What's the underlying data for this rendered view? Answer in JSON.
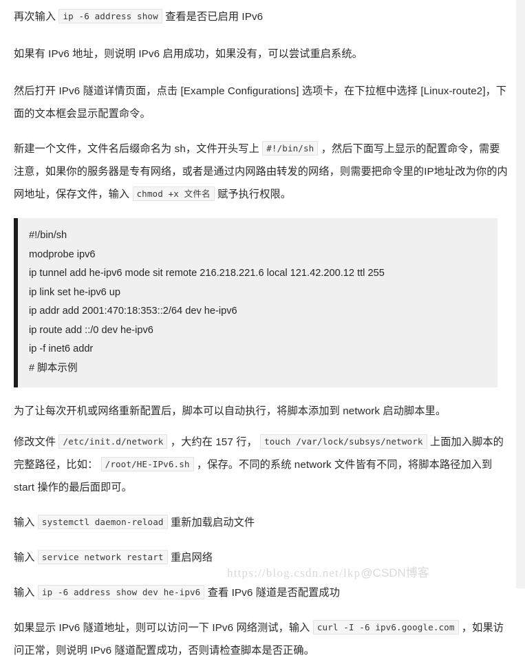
{
  "document": {
    "type": "blog-article-body",
    "language": "zh-CN",
    "topic": "IPv6 tunnel configuration (HE tunnelbroker) on Linux"
  },
  "paragraphs": {
    "p1": {
      "before": "再次输入",
      "code": "ip -6 address show",
      "after": "查看是否已启用 IPv6"
    },
    "p2": "如果有 IPv6 地址，则说明 IPv6 启用成功，如果没有，可以尝试重启系统。",
    "p3": "然后打开 IPv6 隧道详情页面，点击 [Example Configurations] 选项卡，在下拉框中选择 [Linux-route2]，下面的文本框会显示配置命令。",
    "p4": {
      "seg1": "新建一个文件，文件名后缀命名为 sh，文件开头写上",
      "code1": "#!/bin/sh",
      "seg2": "，然后下面写上显示的配置命令，需要注意，如果你的服务器是专有网络，或者是通过内网路由转发的网络，则需要把命令里的IP地址改为你的内网地址，保存文件，输入",
      "code2": "chmod +x 文件名",
      "seg3": "赋予执行权限。"
    },
    "p5": "为了让每次开机或网络重新配置后，脚本可以自动执行，将脚本添加到 network 启动脚本里。",
    "p6": {
      "seg1": "修改文件",
      "code1": "/etc/init.d/network",
      "seg2": "，大约在 157 行，",
      "code2": "touch /var/lock/subsys/network",
      "seg3": "上面加入脚本的完整路径，比如：",
      "code3": "/root/HE-IPv6.sh",
      "seg4": "，保存。不同的系统 network 文件皆有不同，将脚本路径加入到 start 操作的最后面即可。"
    },
    "p7": {
      "before": "输入",
      "code": "systemctl daemon-reload",
      "after": "重新加载启动文件"
    },
    "p8": {
      "before": "输入",
      "code": "service network restart",
      "after": "重启网络"
    },
    "p9": {
      "before": "输入",
      "code": "ip -6 address show dev he-ipv6",
      "after": "查看 IPv6 隧道是否配置成功"
    },
    "p10": {
      "seg1": "如果显示 IPv6 隧道地址，则可以访问一下 IPv6 网络测试，输入",
      "code1": "curl -I -6 ipv6.google.com",
      "seg2": "，如果访问正常，则说明 IPv6 隧道配置成功，否则请检查脚本是否正确。"
    }
  },
  "code_block": {
    "language": "sh",
    "lines": [
      "#!/bin/sh",
      "modprobe ipv6",
      "ip tunnel add he-ipv6 mode sit remote 216.218.221.6 local 121.42.200.12 ttl 255",
      "ip link set he-ipv6 up",
      "ip addr add 2001:470:18:353::2/64 dev he-ipv6",
      "ip route add ::/0 dev he-ipv6",
      "ip -f inet6 addr",
      "# 脚本示例"
    ]
  },
  "watermark": {
    "text": "https://blog.csdn.net/lkp",
    "tail": "@CSDN博客"
  },
  "colors": {
    "page_background": "#ffffff",
    "gutter_background": "#f2f2f2",
    "text": "#2b2b2b",
    "inline_code_background": "#f6f6f6",
    "inline_code_border": "#e3e3e3",
    "code_block_background": "#f0f0f0",
    "code_block_accent": "#1c1c1c",
    "watermark": "#d9d9d9"
  }
}
